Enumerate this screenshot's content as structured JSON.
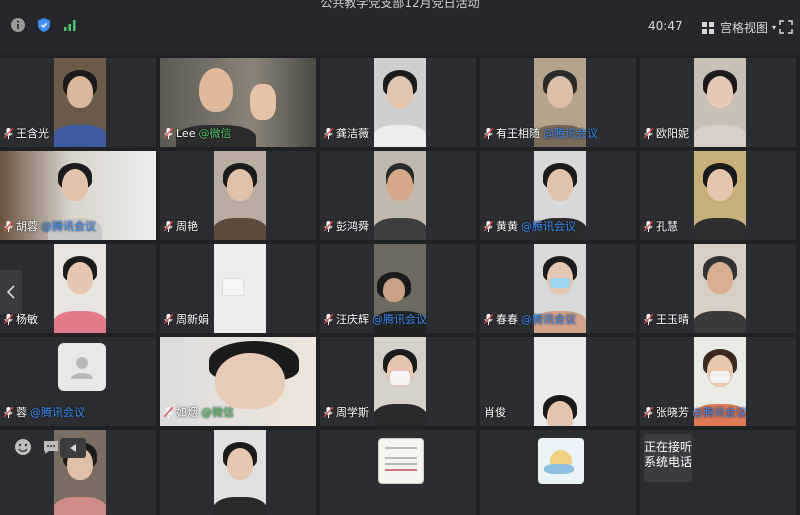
{
  "header": {
    "title": "公共教学党支部12月党日活动",
    "timer": "40:47",
    "view_mode": "宫格视图"
  },
  "icons": {
    "info": "info-icon",
    "shield": "shield-icon",
    "signal": "signal-icon",
    "grid": "grid-view-icon",
    "fullscreen": "fullscreen-icon",
    "emoji": "emoji-icon",
    "chat": "chat-icon",
    "prev": "chevron-left-icon"
  },
  "participants": [
    {
      "name": "王含光",
      "tag": "",
      "tag_color": ""
    },
    {
      "name": "Lee",
      "tag": "@微信",
      "tag_color": "green"
    },
    {
      "name": "龚洁薇",
      "tag": "",
      "tag_color": ""
    },
    {
      "name": "有王相随",
      "tag": "@腾讯会议",
      "tag_color": "blue"
    },
    {
      "name": "欧阳妮",
      "tag": "",
      "tag_color": ""
    },
    {
      "name": "胡蓉",
      "tag": "@腾讯会议",
      "tag_color": "blue"
    },
    {
      "name": "周艳",
      "tag": "",
      "tag_color": ""
    },
    {
      "name": "彭鸿舜",
      "tag": "",
      "tag_color": ""
    },
    {
      "name": "黄黄",
      "tag": "@腾讯会议",
      "tag_color": "blue"
    },
    {
      "name": "孔慧",
      "tag": "",
      "tag_color": ""
    },
    {
      "name": "杨敏",
      "tag": "",
      "tag_color": ""
    },
    {
      "name": "周新娟",
      "tag": "",
      "tag_color": ""
    },
    {
      "name": "汪庆辉",
      "tag": "@腾讯会议",
      "tag_color": "blue"
    },
    {
      "name": "春春",
      "tag": "@腾讯会议",
      "tag_color": "blue"
    },
    {
      "name": "王玉晴",
      "tag": "",
      "tag_color": ""
    },
    {
      "name": "蓉",
      "tag": "@腾讯会议",
      "tag_color": "blue"
    },
    {
      "name": "如烟",
      "tag": "@微信",
      "tag_color": "green"
    },
    {
      "name": "周学斯",
      "tag": "",
      "tag_color": ""
    },
    {
      "name": "肖俊",
      "tag": "",
      "tag_color": ""
    },
    {
      "name": "张晓芳",
      "tag": "@腾讯会议",
      "tag_color": "blue"
    }
  ],
  "status": {
    "busy_line1": "正在接听",
    "busy_line2": "系统电话"
  },
  "colors": {
    "accent_blue": "#3d8ef7",
    "wechat_green": "#4fc26f",
    "background": "#1f2125"
  }
}
